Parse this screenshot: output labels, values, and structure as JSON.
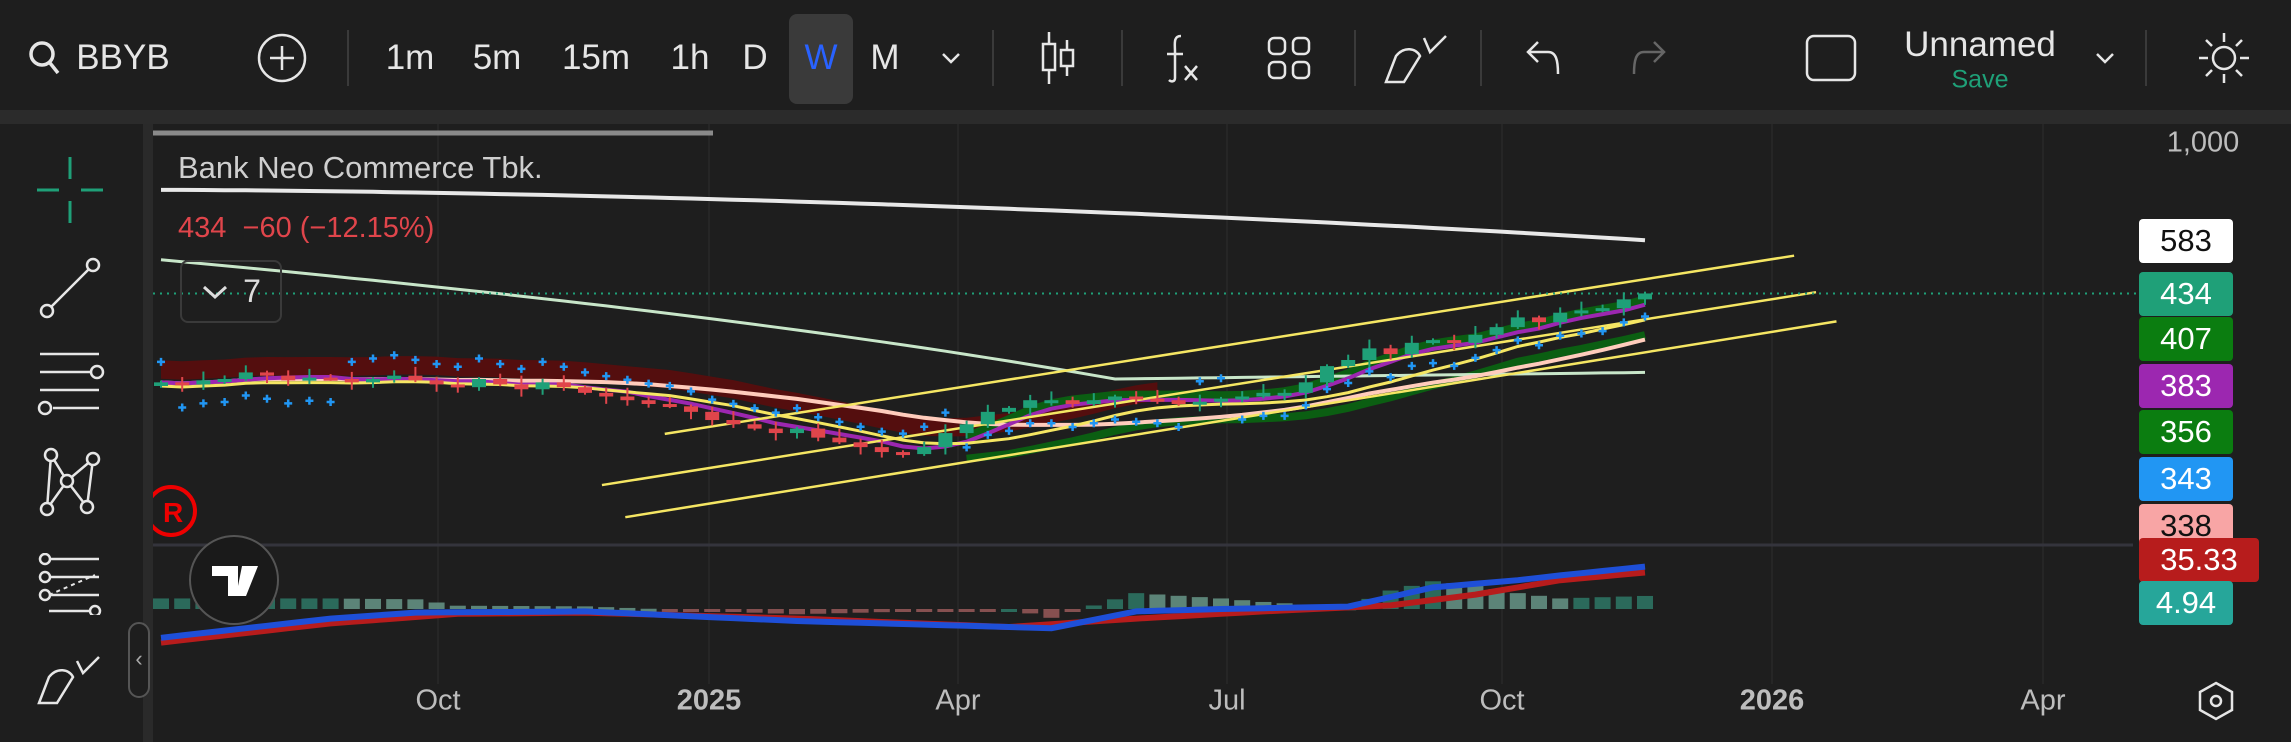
{
  "toolbar": {
    "symbol": "BBYB",
    "intervals": [
      "1m",
      "5m",
      "15m",
      "1h",
      "D",
      "W",
      "M"
    ],
    "active_interval": "W",
    "layout_name": "Unnamed",
    "save_label": "Save"
  },
  "legend": {
    "title": "Bank Neo Commerce Tbk.",
    "last": "434",
    "change": "−60 (−12.15%)",
    "indicator_count": "7"
  },
  "price_axis": {
    "top_label": "1,000",
    "labels": [
      {
        "text": "583",
        "bg": "#ffffff",
        "fg": "#111111"
      },
      {
        "text": "434",
        "bg": "#1fa078",
        "fg": "#ffffff"
      },
      {
        "text": "407",
        "bg": "#0b7d10",
        "fg": "#ffffff"
      },
      {
        "text": "383",
        "bg": "#9c27b0",
        "fg": "#ffffff"
      },
      {
        "text": "356",
        "bg": "#0b7d10",
        "fg": "#ffffff"
      },
      {
        "text": "343",
        "bg": "#2196f3",
        "fg": "#ffffff"
      },
      {
        "text": "338",
        "bg": "#f8a5a5",
        "fg": "#111111"
      }
    ],
    "sub_labels": [
      {
        "text": "35.33",
        "bg": "#b71c1c",
        "fg": "#ffffff"
      },
      {
        "text": "4.94",
        "bg": "#26a69a",
        "fg": "#ffffff"
      }
    ]
  },
  "time_axis": [
    {
      "text": "Oct",
      "bold": false
    },
    {
      "text": "2025",
      "bold": true
    },
    {
      "text": "Apr",
      "bold": false
    },
    {
      "text": "Jul",
      "bold": false
    },
    {
      "text": "Oct",
      "bold": false
    },
    {
      "text": "2026",
      "bold": true
    },
    {
      "text": "Apr",
      "bold": false
    }
  ],
  "colors": {
    "up": "#1fa078",
    "down": "#e0454b",
    "accent": "#2962ff",
    "save": "#1fa078"
  },
  "chart_data": {
    "type": "candlestick",
    "scale": "log",
    "closes": [
      265,
      262,
      268,
      270,
      280,
      275,
      268,
      272,
      270,
      265,
      270,
      275,
      268,
      262,
      258,
      270,
      262,
      255,
      265,
      258,
      250,
      245,
      240,
      235,
      232,
      225,
      215,
      210,
      205,
      200,
      205,
      195,
      190,
      185,
      180,
      178,
      185,
      200,
      210,
      225,
      230,
      240,
      240,
      235,
      240,
      245,
      242,
      240,
      235,
      238,
      242,
      245,
      250,
      250,
      265,
      290,
      300,
      320,
      310,
      330,
      335,
      330,
      345,
      360,
      380,
      370,
      390,
      395,
      400,
      420,
      434
    ],
    "macd_keys": [
      [
        0,
        -24
      ],
      [
        8,
        -8
      ],
      [
        12,
        -3
      ],
      [
        20,
        -2
      ],
      [
        30,
        -10
      ],
      [
        38,
        -14
      ],
      [
        42,
        -16
      ],
      [
        46,
        -2
      ],
      [
        50,
        0
      ],
      [
        56,
        2
      ],
      [
        60,
        18
      ],
      [
        64,
        24
      ],
      [
        66,
        28
      ],
      [
        70,
        35.33
      ]
    ],
    "signal_keys": [
      [
        0,
        -28
      ],
      [
        8,
        -12
      ],
      [
        14,
        -4
      ],
      [
        20,
        -3
      ],
      [
        30,
        -8
      ],
      [
        40,
        -15
      ],
      [
        46,
        -8
      ],
      [
        52,
        -2
      ],
      [
        58,
        3
      ],
      [
        62,
        12
      ],
      [
        66,
        24
      ],
      [
        70,
        30.39
      ]
    ]
  }
}
